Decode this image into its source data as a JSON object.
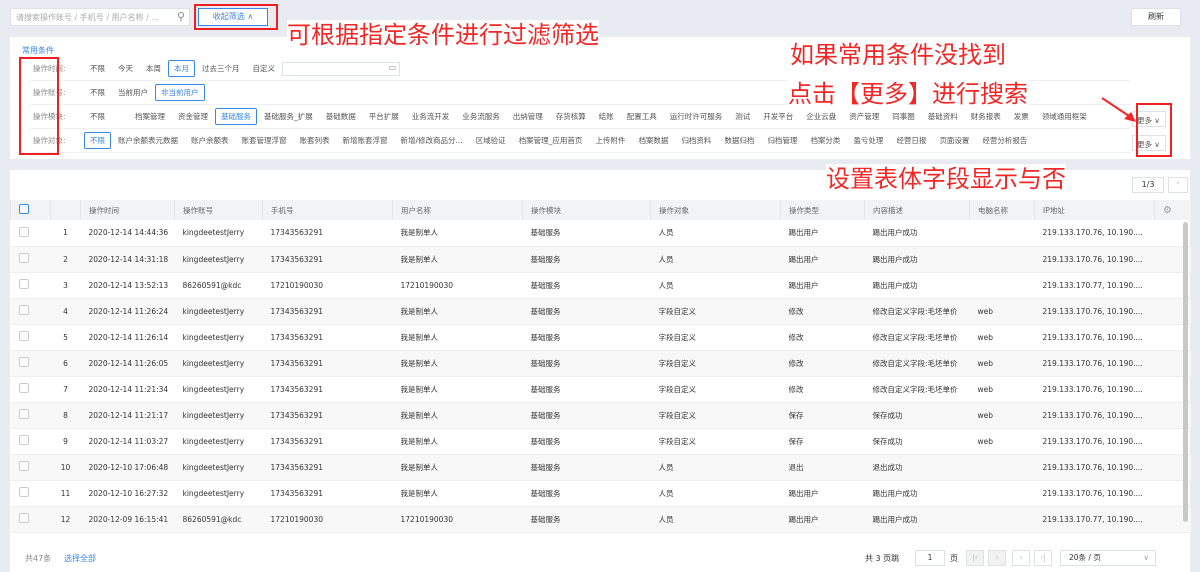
{
  "search": {
    "placeholder": "请搜索操作账号 / 手机号 / 用户名称 / ..."
  },
  "toolbar": {
    "collapse_label": "收起筛选 ∧",
    "refresh_label": "刷新"
  },
  "annotations": {
    "a1": "可根据指定条件进行过滤筛选",
    "a2": "如果常用条件没找到",
    "a3": "点击【更多】进行搜索",
    "a4": "设置表体字段显示与否"
  },
  "filters": {
    "title": "常用条件",
    "more_label": "更多 ∨",
    "rows": [
      {
        "label": "操作时间:",
        "options": [
          "不限",
          "今天",
          "本周",
          "本月",
          "过去三个月",
          "自定义"
        ],
        "selected": 3
      },
      {
        "label": "操作账号:",
        "options": [
          "不限",
          "当前用户",
          "非当前用户"
        ],
        "selected": 2
      },
      {
        "label": "操作模块:",
        "options": [
          "不限",
          "档案管理",
          "资金管理",
          "基础服务",
          "基础服务_扩展",
          "基础数据",
          "平台扩展",
          "业务流开发",
          "业务流服务",
          "出纳管理",
          "存货核算",
          "结账",
          "配置工具",
          "运行时许可服务",
          "测试",
          "开发平台",
          "企业云盘",
          "资产管理",
          "同事圈",
          "基础资料",
          "财务报表",
          "发票",
          "领域通用框架"
        ],
        "selected": 3
      },
      {
        "label": "操作对象:",
        "options": [
          "不限",
          "账户余额表元数据",
          "账户余额表",
          "账套管理浮窗",
          "账套列表",
          "新增账套浮窗",
          "新增/修改商品分...",
          "区域验证",
          "档案管理_应用首页",
          "上传附件",
          "档案数据",
          "归档资料",
          "数据归档",
          "归档管理",
          "档案分类",
          "盈亏处理",
          "经营日报",
          "页面设置",
          "经营分析报告"
        ],
        "selected": 0
      }
    ]
  },
  "pager_top": "1/3",
  "table": {
    "columns": [
      "",
      "",
      "操作时间",
      "操作账号",
      "手机号",
      "用户名称",
      "操作模块",
      "操作对象",
      "操作类型",
      "内容描述",
      "电脑名称",
      "IP地址"
    ],
    "rows": [
      [
        "1",
        "2020-12-14 14:44:36",
        "kingdeetestJerry",
        "17343563291",
        "我是制单人",
        "基础服务",
        "人员",
        "踢出用户",
        "踢出用户成功",
        "",
        "219.133.170.76, 10.190...."
      ],
      [
        "2",
        "2020-12-14 14:31:18",
        "kingdeetestJerry",
        "17343563291",
        "我是制单人",
        "基础服务",
        "人员",
        "踢出用户",
        "踢出用户成功",
        "",
        "219.133.170.76, 10.190...."
      ],
      [
        "3",
        "2020-12-14 13:52:13",
        "86260591@kdc",
        "17210190030",
        "17210190030",
        "基础服务",
        "人员",
        "踢出用户",
        "踢出用户成功",
        "",
        "219.133.170.77, 10.190...."
      ],
      [
        "4",
        "2020-12-14 11:26:24",
        "kingdeetestJerry",
        "17343563291",
        "我是制单人",
        "基础服务",
        "字段自定义",
        "修改",
        "修改自定义字段:毛坯单价",
        "web",
        "219.133.170.76, 10.190...."
      ],
      [
        "5",
        "2020-12-14 11:26:14",
        "kingdeetestJerry",
        "17343563291",
        "我是制单人",
        "基础服务",
        "字段自定义",
        "修改",
        "修改自定义字段:毛坯单价",
        "web",
        "219.133.170.76, 10.190...."
      ],
      [
        "6",
        "2020-12-14 11:26:05",
        "kingdeetestJerry",
        "17343563291",
        "我是制单人",
        "基础服务",
        "字段自定义",
        "修改",
        "修改自定义字段:毛坯单价",
        "web",
        "219.133.170.76, 10.190...."
      ],
      [
        "7",
        "2020-12-14 11:21:34",
        "kingdeetestJerry",
        "17343563291",
        "我是制单人",
        "基础服务",
        "字段自定义",
        "修改",
        "修改自定义字段:毛坯单价",
        "web",
        "219.133.170.76, 10.190...."
      ],
      [
        "8",
        "2020-12-14 11:21:17",
        "kingdeetestJerry",
        "17343563291",
        "我是制单人",
        "基础服务",
        "字段自定义",
        "保存",
        "保存成功",
        "web",
        "219.133.170.76, 10.190...."
      ],
      [
        "9",
        "2020-12-14 11:03:27",
        "kingdeetestJerry",
        "17343563291",
        "我是制单人",
        "基础服务",
        "字段自定义",
        "保存",
        "保存成功",
        "web",
        "219.133.170.76, 10.190...."
      ],
      [
        "10",
        "2020-12-10 17:06:48",
        "kingdeetestJerry",
        "17343563291",
        "我是制单人",
        "基础服务",
        "人员",
        "退出",
        "退出成功",
        "",
        "219.133.170.76, 10.190...."
      ],
      [
        "11",
        "2020-12-10 16:27:32",
        "kingdeetestJerry",
        "17343563291",
        "我是制单人",
        "基础服务",
        "人员",
        "踢出用户",
        "踢出用户成功",
        "",
        "219.133.170.76, 10.190...."
      ],
      [
        "12",
        "2020-12-09 16:15:41",
        "86260591@kdc",
        "17210190030",
        "17210190030",
        "基础服务",
        "人员",
        "踢出用户",
        "踢出用户成功",
        "",
        "219.133.170.77, 10.190...."
      ]
    ]
  },
  "footer": {
    "total": "共47条",
    "select_all": "选择全部",
    "pages": "共 3 页跳",
    "page": "1",
    "page_unit": "页",
    "page_size": "20条 / 页"
  },
  "colors": {
    "accent": "#3a86e8",
    "annotation": "#f02828"
  }
}
